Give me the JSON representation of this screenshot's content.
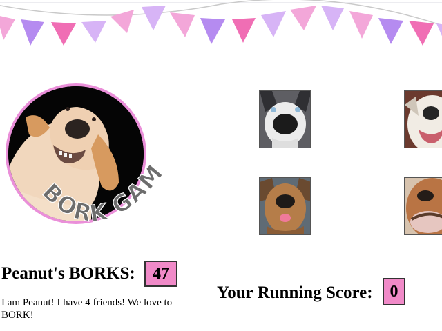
{
  "game": {
    "logo_text": "BORK GAME",
    "main_dog": "Peanut",
    "borks_label": "Peanut's BORKS:",
    "borks_count": "47",
    "about_text": "I am Peanut! I have 4 friends! We love to BORK!",
    "running_score_label": "Your Running Score:",
    "running_score": "0"
  },
  "friends": [
    {
      "icon": "husky-dog-photo"
    },
    {
      "icon": "white-dog-photo"
    },
    {
      "icon": "brown-dog-tongue-photo"
    },
    {
      "icon": "boxer-dog-photo"
    }
  ],
  "colors": {
    "accent_pink": "#f08ac8",
    "frame_pink": "#ea8fd9",
    "pennant_pink": "#f3a7d9",
    "pennant_purple": "#b58bf0",
    "pennant_magenta": "#f06eb4"
  }
}
